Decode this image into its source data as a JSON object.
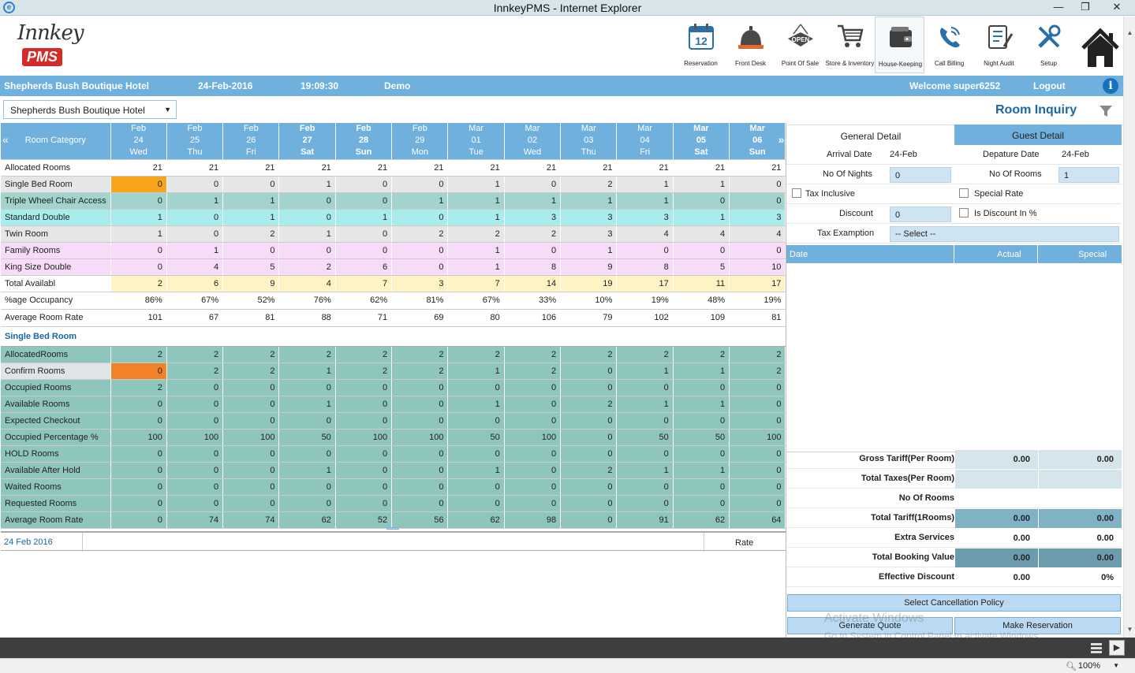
{
  "window": {
    "title": "InnkeyPMS - Internet Explorer"
  },
  "logo": {
    "script_text": "Innkey",
    "badge_text": "PMS"
  },
  "toolbar": [
    {
      "label": "Reservation",
      "icon": "calendar-icon",
      "day": "12"
    },
    {
      "label": "Front Desk",
      "icon": "bell-icon"
    },
    {
      "label": "Point Of Sale",
      "icon": "open-sign-icon",
      "sign": "OPEN"
    },
    {
      "label": "Store & Inventory",
      "icon": "shopping-cart-icon"
    },
    {
      "label": "House-Keeping",
      "icon": "wallet-icon"
    },
    {
      "label": "Call Billing",
      "icon": "phone-icon"
    },
    {
      "label": "Night Audit",
      "icon": "checklist-icon"
    },
    {
      "label": "Setup",
      "icon": "tools-icon"
    },
    {
      "label": "",
      "icon": "home-icon"
    }
  ],
  "infobar": {
    "hotel": "Shepherds Bush Boutique Hotel",
    "date": "24-Feb-2016",
    "time": "19:09:30",
    "mode": "Demo",
    "welcome": "Welcome super6252",
    "logout": "Logout",
    "info": "i"
  },
  "hotel_select": {
    "value": "Shepherds Bush Boutique Hotel"
  },
  "page_title": "Room Inquiry",
  "grid": {
    "category_header": "Room Category",
    "dates": [
      {
        "month": "Feb",
        "day": "24",
        "dow": "Wed",
        "bold": false
      },
      {
        "month": "Feb",
        "day": "25",
        "dow": "Thu",
        "bold": false
      },
      {
        "month": "Feb",
        "day": "26",
        "dow": "Fri",
        "bold": false
      },
      {
        "month": "Feb",
        "day": "27",
        "dow": "Sat",
        "bold": true
      },
      {
        "month": "Feb",
        "day": "28",
        "dow": "Sun",
        "bold": true
      },
      {
        "month": "Feb",
        "day": "29",
        "dow": "Mon",
        "bold": false
      },
      {
        "month": "Mar",
        "day": "01",
        "dow": "Tue",
        "bold": false
      },
      {
        "month": "Mar",
        "day": "02",
        "dow": "Wed",
        "bold": false
      },
      {
        "month": "Mar",
        "day": "03",
        "dow": "Thu",
        "bold": false
      },
      {
        "month": "Mar",
        "day": "04",
        "dow": "Fri",
        "bold": false
      },
      {
        "month": "Mar",
        "day": "05",
        "dow": "Sat",
        "bold": true
      },
      {
        "month": "Mar",
        "day": "06",
        "dow": "Sun",
        "bold": true
      }
    ],
    "rows": [
      {
        "name": "Allocated Rooms",
        "style": "r-white",
        "values": [
          "21",
          "21",
          "21",
          "21",
          "21",
          "21",
          "21",
          "21",
          "21",
          "21",
          "21",
          "21"
        ]
      },
      {
        "name": "Single Bed Room",
        "style": "r-grey",
        "highlight": 0,
        "values": [
          "0",
          "0",
          "0",
          "1",
          "0",
          "0",
          "1",
          "0",
          "2",
          "1",
          "1",
          "0"
        ]
      },
      {
        "name": "Triple Wheel Chair Access",
        "style": "r-teal",
        "values": [
          "0",
          "1",
          "1",
          "0",
          "0",
          "1",
          "1",
          "1",
          "1",
          "1",
          "0",
          "0"
        ]
      },
      {
        "name": "Standard Double",
        "style": "r-cyan",
        "values": [
          "1",
          "0",
          "1",
          "0",
          "1",
          "0",
          "1",
          "3",
          "3",
          "3",
          "1",
          "3"
        ]
      },
      {
        "name": "Twin Room",
        "style": "r-grey",
        "values": [
          "1",
          "0",
          "2",
          "1",
          "0",
          "2",
          "2",
          "2",
          "3",
          "4",
          "4",
          "4"
        ]
      },
      {
        "name": "Family Rooms",
        "style": "r-pink",
        "values": [
          "0",
          "1",
          "0",
          "0",
          "0",
          "0",
          "1",
          "0",
          "1",
          "0",
          "0",
          "0"
        ]
      },
      {
        "name": "King Size Double",
        "style": "r-pink",
        "values": [
          "0",
          "4",
          "5",
          "2",
          "6",
          "0",
          "1",
          "8",
          "9",
          "8",
          "5",
          "10"
        ]
      },
      {
        "name": "Total Availabl",
        "style": "r-yellow",
        "values": [
          "2",
          "6",
          "9",
          "4",
          "7",
          "3",
          "7",
          "14",
          "19",
          "17",
          "11",
          "17"
        ]
      },
      {
        "name": "%age Occupancy",
        "style": "r-white r-tall",
        "values": [
          "86%",
          "67%",
          "52%",
          "76%",
          "62%",
          "81%",
          "67%",
          "33%",
          "10%",
          "19%",
          "48%",
          "19%"
        ]
      },
      {
        "name": "Average Room Rate",
        "style": "r-white r-tall",
        "values": [
          "101",
          "67",
          "81",
          "88",
          "71",
          "69",
          "80",
          "106",
          "79",
          "102",
          "109",
          "81"
        ]
      }
    ],
    "section_title": "Single Bed Room",
    "detail_rows": [
      {
        "name": "AllocatedRooms",
        "style": "r-gteal",
        "values": [
          "2",
          "2",
          "2",
          "2",
          "2",
          "2",
          "2",
          "2",
          "2",
          "2",
          "2",
          "2"
        ]
      },
      {
        "name": "Confirm Rooms",
        "style": "r-confirm",
        "highlight": 0,
        "values": [
          "0",
          "2",
          "2",
          "1",
          "2",
          "2",
          "1",
          "2",
          "0",
          "1",
          "1",
          "2"
        ]
      },
      {
        "name": "Occupied Rooms",
        "style": "r-gteal",
        "values": [
          "2",
          "0",
          "0",
          "0",
          "0",
          "0",
          "0",
          "0",
          "0",
          "0",
          "0",
          "0"
        ]
      },
      {
        "name": "Available Rooms",
        "style": "r-gteal",
        "values": [
          "0",
          "0",
          "0",
          "1",
          "0",
          "0",
          "1",
          "0",
          "2",
          "1",
          "1",
          "0"
        ]
      },
      {
        "name": "Expected Checkout",
        "style": "r-gteal",
        "values": [
          "0",
          "0",
          "0",
          "0",
          "0",
          "0",
          "0",
          "0",
          "0",
          "0",
          "0",
          "0"
        ]
      },
      {
        "name": "Occupied Percentage %",
        "style": "r-gteal",
        "values": [
          "100",
          "100",
          "100",
          "50",
          "100",
          "100",
          "50",
          "100",
          "0",
          "50",
          "50",
          "100"
        ]
      },
      {
        "name": "HOLD Rooms",
        "style": "r-gteal",
        "values": [
          "0",
          "0",
          "0",
          "0",
          "0",
          "0",
          "0",
          "0",
          "0",
          "0",
          "0",
          "0"
        ]
      },
      {
        "name": "Available After Hold",
        "style": "r-gteal",
        "values": [
          "0",
          "0",
          "0",
          "1",
          "0",
          "0",
          "1",
          "0",
          "2",
          "1",
          "1",
          "0"
        ]
      },
      {
        "name": "Waited Rooms",
        "style": "r-gteal",
        "values": [
          "0",
          "0",
          "0",
          "0",
          "0",
          "0",
          "0",
          "0",
          "0",
          "0",
          "0",
          "0"
        ]
      },
      {
        "name": "Requested Rooms",
        "style": "r-gteal",
        "values": [
          "0",
          "0",
          "0",
          "0",
          "0",
          "0",
          "0",
          "0",
          "0",
          "0",
          "0",
          "0"
        ]
      },
      {
        "name": "Average Room Rate",
        "style": "r-gteal",
        "values": [
          "0",
          "74",
          "74",
          "62",
          "52",
          "56",
          "62",
          "98",
          "0",
          "91",
          "62",
          "64"
        ]
      }
    ]
  },
  "footer": {
    "date": "24 Feb 2016",
    "rate_label": "Rate"
  },
  "detail_panel": {
    "tab_general": "General Detail",
    "tab_guest": "Guest Detail",
    "arrival_label": "Arrival Date",
    "arrival_value": "24-Feb",
    "departure_label": "Depature Date",
    "departure_value": "24-Feb",
    "nights_label": "No Of Nights",
    "nights_value": "0",
    "rooms_label": "No Of Rooms",
    "rooms_value": "1",
    "tax_inclusive_label": "Tax Inclusive",
    "special_rate_label": "Special Rate",
    "discount_label": "Discount",
    "discount_value": "0",
    "discount_pct_label": "Is Discount In %",
    "tax_exemption_label": "Tax Examption",
    "tax_exemption_value": "-- Select --",
    "grid_date": "Date",
    "grid_actual": "Actual",
    "grid_special": "Special"
  },
  "totals": [
    {
      "label": "Gross Tariff(Per Room)",
      "style": "t-light",
      "a": "0.00",
      "b": "0.00"
    },
    {
      "label": "Total Taxes(Per Room)",
      "style": "t-light",
      "a": "",
      "b": ""
    },
    {
      "label": "No Of Rooms",
      "style": "",
      "a": "",
      "b": ""
    },
    {
      "label": "Total Tariff(1Rooms)",
      "style": "t-mid",
      "a": "0.00",
      "b": "0.00"
    },
    {
      "label": "Extra Services",
      "style": "",
      "a": "0.00",
      "b": "0.00"
    },
    {
      "label": "Total Booking Value",
      "style": "t-dark",
      "a": "0.00",
      "b": "0.00"
    },
    {
      "label": "Effective Discount",
      "style": "",
      "a": "0.00",
      "b": "0%"
    }
  ],
  "buttons": {
    "cancellation": "Select Cancellation Policy",
    "quote": "Generate Quote",
    "reserve": "Make Reservation"
  },
  "watermark": {
    "line1": "Activate Windows",
    "line2": "Go to System in Control Panel to activate Windows."
  },
  "iestatus": {
    "zoom": "100%"
  }
}
